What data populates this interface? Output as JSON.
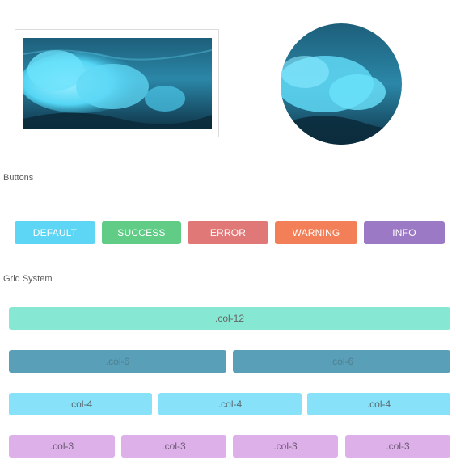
{
  "images": {
    "rect_alt": "",
    "circle_alt": ""
  },
  "buttons_section": {
    "label": "Buttons",
    "items": [
      {
        "label": "DEFAULT",
        "color": "#5dd5f5"
      },
      {
        "label": "SUCCESS",
        "color": "#60cc86"
      },
      {
        "label": "ERROR",
        "color": "#e07878"
      },
      {
        "label": "WARNING",
        "color": "#f27f58"
      },
      {
        "label": "INFO",
        "color": "#9c79c4"
      }
    ]
  },
  "grid_section": {
    "label": "Grid System",
    "rows": [
      {
        "cols": [
          ".col-12"
        ],
        "color": "#86e7d2",
        "text_color": "#666666"
      },
      {
        "cols": [
          ".col-6",
          ".col-6"
        ],
        "color": "#599fb8",
        "text_color": "#4f7f8f"
      },
      {
        "cols": [
          ".col-4",
          ".col-4",
          ".col-4"
        ],
        "color": "#86e1f9",
        "text_color": "#5a6d74"
      },
      {
        "cols": [
          ".col-3",
          ".col-3",
          ".col-3",
          ".col-3"
        ],
        "color": "#ddb0ea",
        "text_color": "#6c5a72"
      }
    ]
  }
}
